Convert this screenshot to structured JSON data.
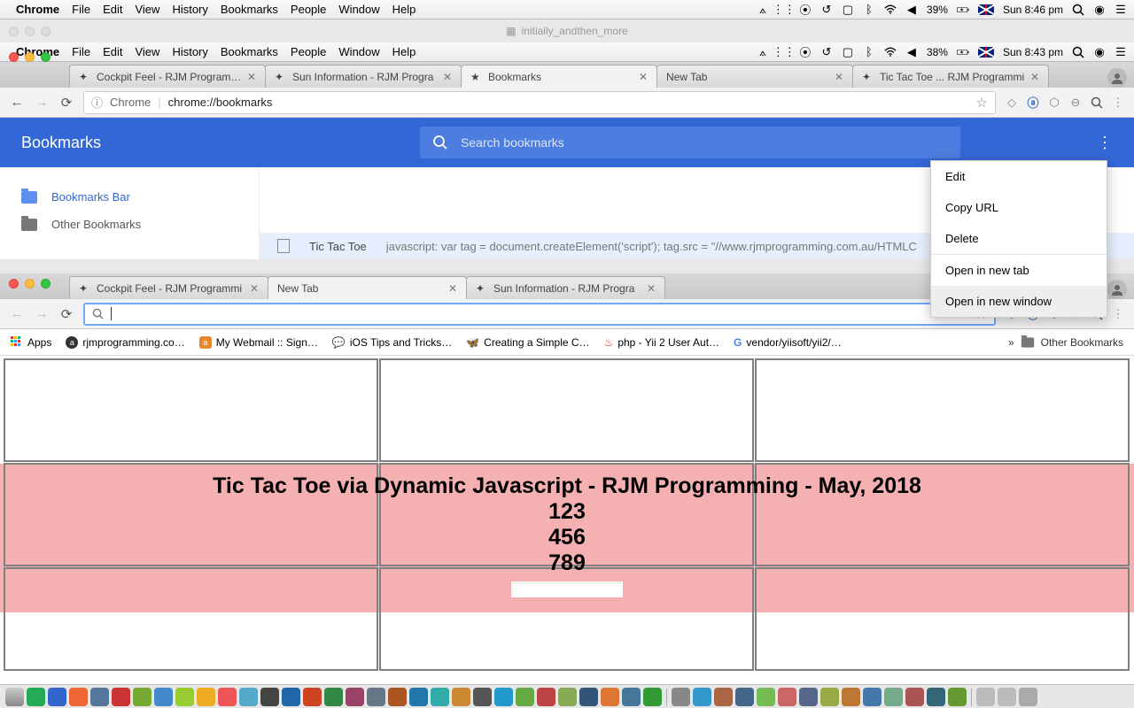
{
  "outer_menubar": {
    "app": "Chrome",
    "menus": [
      "File",
      "Edit",
      "View",
      "History",
      "Bookmarks",
      "People",
      "Window",
      "Help"
    ],
    "battery": "39%",
    "clock": "Sun 8:46 pm"
  },
  "image_titlebar": "initially_andthen_more",
  "inner_menubar": {
    "app": "Chrome",
    "menus": [
      "File",
      "Edit",
      "View",
      "History",
      "Bookmarks",
      "People",
      "Window",
      "Help"
    ],
    "battery": "38%",
    "clock": "Sun 8:43 pm"
  },
  "chrome_upper": {
    "tabs": [
      {
        "title": "Cockpit Feel - RJM Programmi"
      },
      {
        "title": "Sun Information - RJM Progra"
      },
      {
        "title": "Bookmarks",
        "active": true
      },
      {
        "title": "New Tab"
      },
      {
        "title": "Tic Tac Toe ... RJM Programmi"
      }
    ],
    "omnibox_prefix": "Chrome",
    "omnibox_url": "chrome://bookmarks",
    "bm_title": "Bookmarks",
    "bm_search_placeholder": "Search bookmarks",
    "sidebar": {
      "bar": "Bookmarks Bar",
      "other": "Other Bookmarks"
    },
    "row": {
      "name": "Tic Tac Toe",
      "url": "javascript: var tag = document.createElement('script'); tag.src = \"//www.rjmprogramming.com.au/HTMLC"
    },
    "context_menu": [
      "Edit",
      "Copy URL",
      "Delete",
      "Open in new tab",
      "Open in new window"
    ],
    "context_hover": 4
  },
  "chrome_lower": {
    "tabs": [
      {
        "title": "Cockpit Feel - RJM Programmi"
      },
      {
        "title": "New Tab",
        "active": true
      },
      {
        "title": "Sun Information - RJM Progra"
      }
    ],
    "bookmarks_bar": {
      "apps": "Apps",
      "items": [
        "rjmprogramming.co…",
        "My Webmail :: Sign…",
        "iOS Tips and Tricks…",
        "Creating a Simple C…",
        "php - Yii 2 User Aut…",
        "vendor/yiisoft/yii2/…"
      ],
      "other": "Other Bookmarks"
    },
    "page": {
      "heading": "Tic Tac Toe via Dynamic Javascript - RJM Programming - May, 2018",
      "rows": [
        "123",
        "456",
        "789"
      ]
    }
  }
}
